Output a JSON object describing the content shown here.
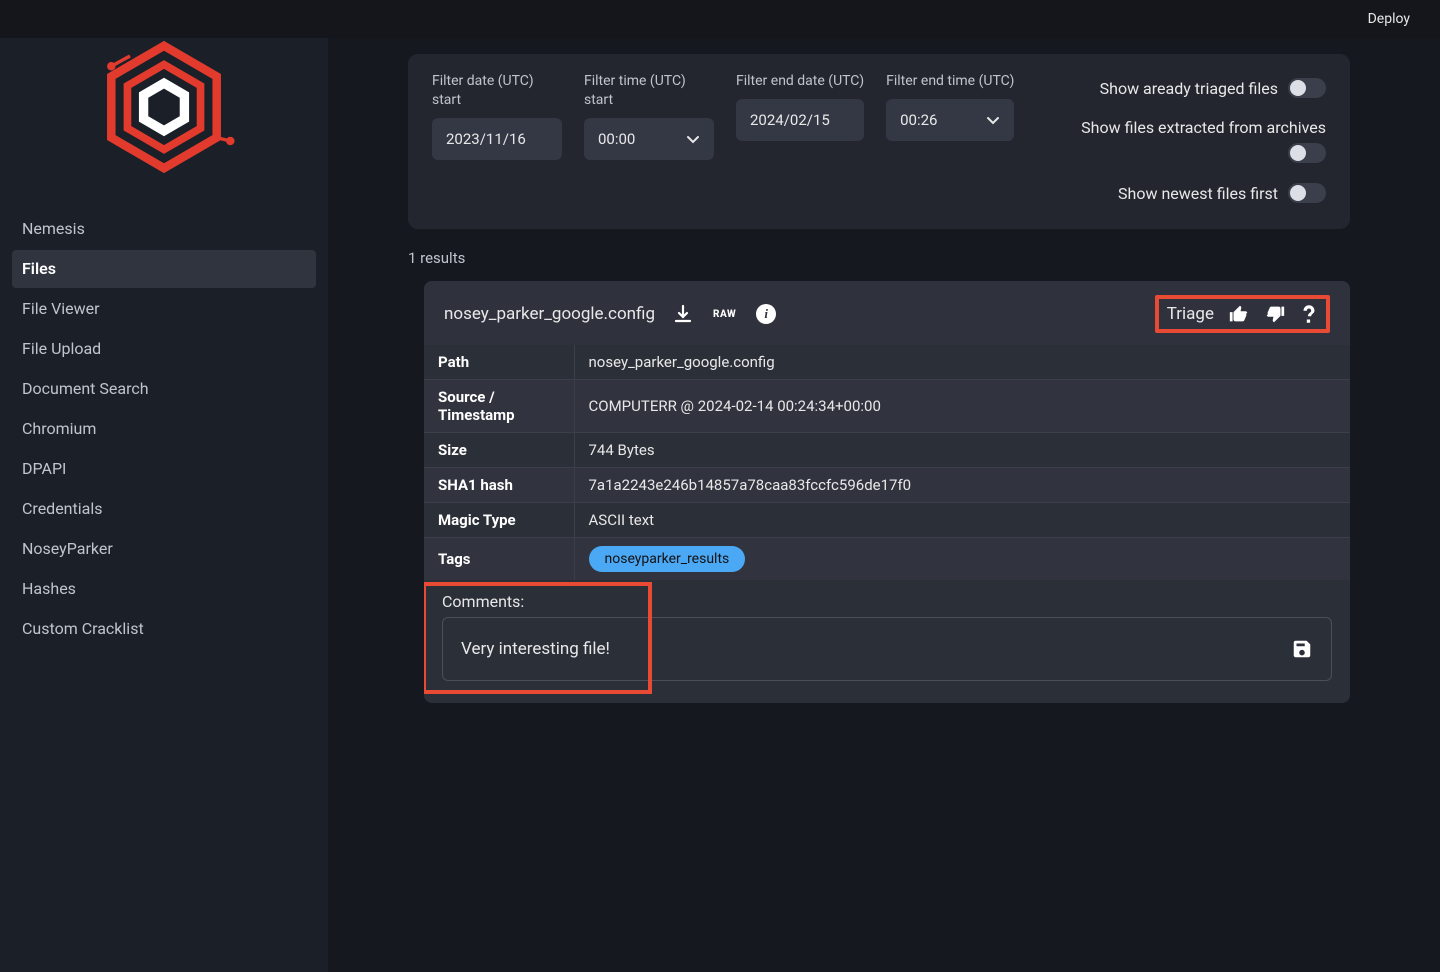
{
  "topbar": {
    "deploy": "Deploy"
  },
  "sidebar": {
    "items": [
      {
        "label": "Nemesis"
      },
      {
        "label": "Files"
      },
      {
        "label": "File Viewer"
      },
      {
        "label": "File Upload"
      },
      {
        "label": "Document Search"
      },
      {
        "label": "Chromium"
      },
      {
        "label": "DPAPI"
      },
      {
        "label": "Credentials"
      },
      {
        "label": "NoseyParker"
      },
      {
        "label": "Hashes"
      },
      {
        "label": "Custom Cracklist"
      }
    ],
    "activeIndex": 1
  },
  "filters": {
    "date_start_label": "Filter date (UTC) start",
    "date_start_value": "2023/11/16",
    "time_start_label": "Filter time (UTC) start",
    "time_start_value": "00:00",
    "date_end_label": "Filter end date (UTC)",
    "date_end_value": "2024/02/15",
    "time_end_label": "Filter end time (UTC)",
    "time_end_value": "00:26",
    "toggle_triaged": "Show aready triaged files",
    "toggle_archives": "Show files extracted from archives",
    "toggle_newest": "Show newest files first"
  },
  "results": {
    "count_text": "1 results"
  },
  "file": {
    "name": "nosey_parker_google.config",
    "raw_label": "RAW",
    "triage_label": "Triage",
    "rows": {
      "path_k": "Path",
      "path_v": "nosey_parker_google.config",
      "source_k": "Source / Timestamp",
      "source_v": "COMPUTERR @ 2024-02-14 00:24:34+00:00",
      "size_k": "Size",
      "size_v": "744 Bytes",
      "sha1_k": "SHA1 hash",
      "sha1_v": "7a1a2243e246b14857a78caa83fccfc596de17f0",
      "magic_k": "Magic Type",
      "magic_v": "ASCII text",
      "tags_k": "Tags",
      "tag_value": "noseyparker_results"
    },
    "comments_label": "Comments:",
    "comments_value": "Very interesting file!"
  }
}
